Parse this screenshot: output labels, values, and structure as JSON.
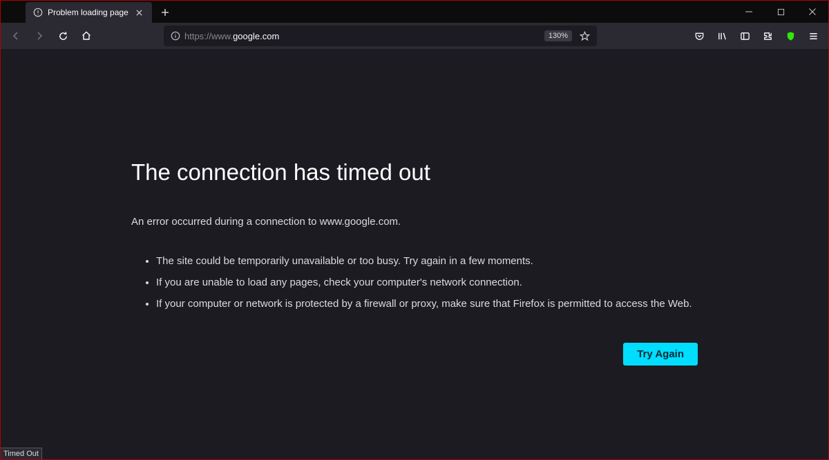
{
  "window": {
    "tab_title": "Problem loading page"
  },
  "navbar": {
    "url_prefix": "https://www.",
    "url_host": "google.com",
    "zoom": "130%"
  },
  "error": {
    "title": "The connection has timed out",
    "short_desc": "An error occurred during a connection to www.google.com.",
    "bullets": [
      "The site could be temporarily unavailable or too busy. Try again in a few moments.",
      "If you are unable to load any pages, check your computer's network connection.",
      "If your computer or network is protected by a firewall or proxy, make sure that Firefox is permitted to access the Web."
    ],
    "try_again": "Try Again"
  },
  "status": {
    "text": "Timed Out"
  }
}
